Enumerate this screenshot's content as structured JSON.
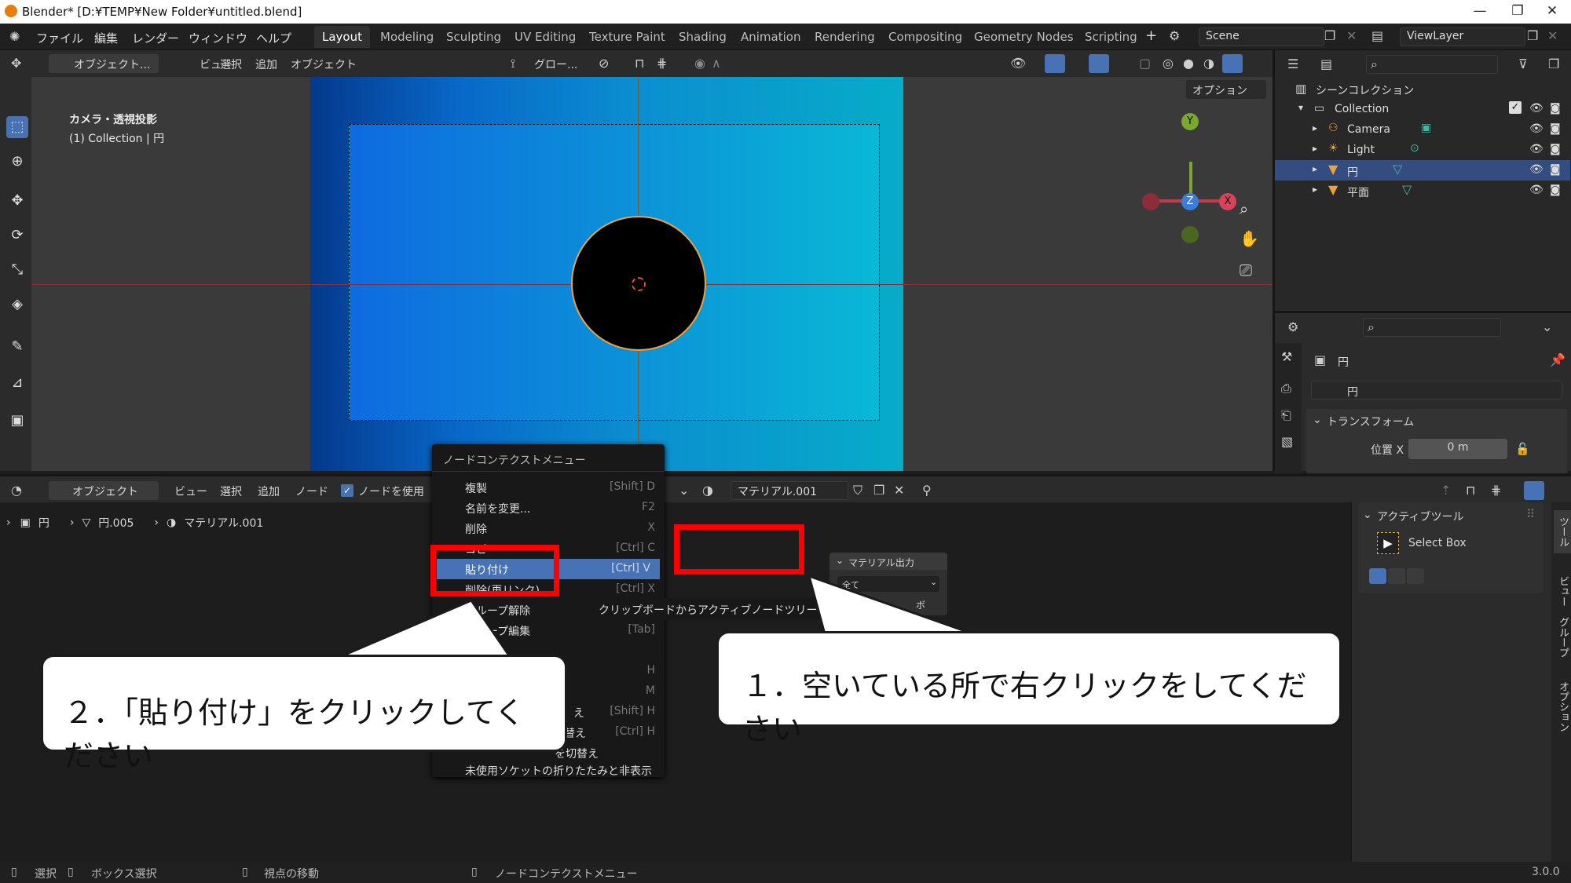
{
  "window": {
    "title": "Blender* [D:¥TEMP¥New Folder¥untitled.blend]",
    "min": "—",
    "max": "❐",
    "close": "✕"
  },
  "menubar": {
    "items": [
      "ファイル",
      "編集",
      "レンダー",
      "ウィンドウ",
      "ヘルプ"
    ]
  },
  "workspaces": [
    "Layout",
    "Modeling",
    "Sculpting",
    "UV Editing",
    "Texture Paint",
    "Shading",
    "Animation",
    "Rendering",
    "Compositing",
    "Geometry Nodes",
    "Scripting"
  ],
  "workspace_add": "+",
  "scene": "Scene",
  "viewlayer": "ViewLayer",
  "viewport_header": {
    "mode": "オブジェクト...",
    "menus": [
      "ビュー",
      "選択",
      "追加",
      "オブジェクト"
    ],
    "transform": "グロー...",
    "options": "オプション"
  },
  "viewport": {
    "camera_label": "カメラ・透視投影",
    "collection_label": "(1) Collection | 円"
  },
  "gizmo": {
    "y": "Y",
    "z": "Z",
    "x": "X"
  },
  "outliner": {
    "root": "シーンコレクション",
    "collection": "Collection",
    "items": [
      {
        "label": "Camera",
        "selected": false,
        "color": "#e8a33b"
      },
      {
        "label": "Light",
        "selected": false,
        "color": "#e8a33b"
      },
      {
        "label": "円",
        "selected": true,
        "color": "#e8a33b"
      },
      {
        "label": "平面",
        "selected": false,
        "color": "#e8a33b"
      }
    ]
  },
  "properties": {
    "object": "円",
    "data": "円",
    "section": "トランスフォーム",
    "loc_label": "位置 X",
    "loc_value": "0 m"
  },
  "node_header": {
    "mode": "オブジェクト",
    "menus": [
      "ビュー",
      "選択",
      "追加",
      "ノード"
    ],
    "use_nodes": "ノードを使用",
    "material": "マテリアル.001"
  },
  "breadcrumb": {
    "obj": "円",
    "mesh": "円.005",
    "mat": "マテリアル.001"
  },
  "material_output": {
    "title": "マテリアル出力",
    "target": "全て",
    "partial": "ボ"
  },
  "npanel": {
    "section": "アクティブツール",
    "tool": "Select Box",
    "tabs": [
      "ツール",
      "ビュー",
      "グループ",
      "オプション"
    ]
  },
  "context_menu": {
    "title": "ノードコンテクストメニュー",
    "items": [
      {
        "label": "複製",
        "shortcut": "[Shift] D"
      },
      {
        "label": "名前を変更...",
        "shortcut": "F2"
      },
      {
        "label": "削除",
        "shortcut": "X"
      },
      {
        "label": "コピー",
        "shortcut": "[Ctrl] C"
      },
      {
        "label": "貼り付け",
        "shortcut": "[Ctrl] V"
      },
      {
        "label": "削除(再リンク)",
        "shortcut": "[Ctrl] X"
      },
      {
        "label": "グループ解除",
        "shortcut": ""
      },
      {
        "label": "グループ編集",
        "shortcut": "[Tab]"
      },
      {
        "label": "",
        "shortcut": ""
      },
      {
        "label": "",
        "shortcut": "H"
      },
      {
        "label": "",
        "shortcut": "M"
      },
      {
        "label": "え",
        "shortcut": "[Shift] H"
      },
      {
        "label": "替え",
        "shortcut": "[Ctrl] H"
      },
      {
        "label": "を切替え",
        "shortcut": ""
      },
      {
        "label": "未使用ソケットの折りたたみと非表示",
        "shortcut": ""
      }
    ]
  },
  "tooltip": "クリップボードからアクティブノードツリー",
  "callouts": {
    "step1": "１．空いている所で右クリックをしてください",
    "step2": "２．「貼り付け」をクリックしてください"
  },
  "statusbar": {
    "select": "選択",
    "box_select": "ボックス選択",
    "move_view": "視点の移動",
    "context": "ノードコンテクストメニュー",
    "version": "3.0.0"
  }
}
